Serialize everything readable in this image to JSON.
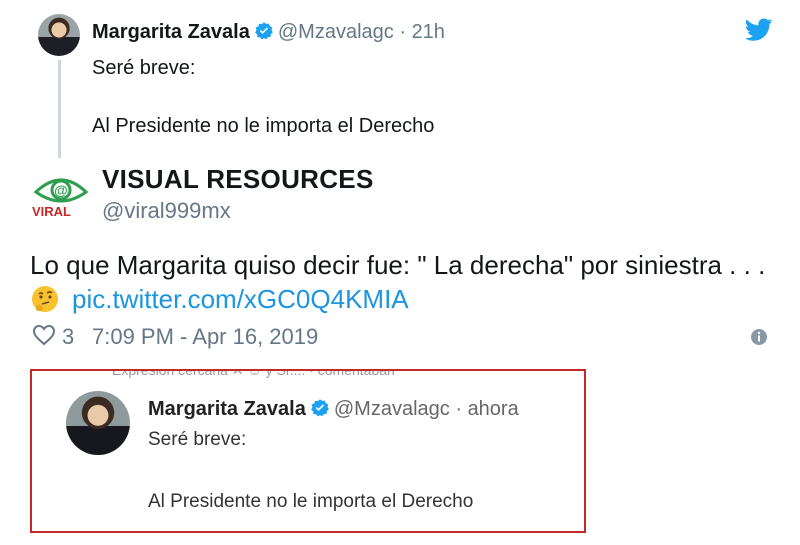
{
  "quoted_tweet": {
    "name": "Margarita Zavala",
    "handle": "@Mzavalagc",
    "separator": "·",
    "time": "21h",
    "line1": "Seré breve:",
    "line2": "Al Presidente no le importa el Derecho"
  },
  "author": {
    "logo_text": "VIRAL",
    "name": "VISUAL RESOURCES",
    "handle": "@viral999mx"
  },
  "tweet": {
    "text": "Lo que Margarita quiso decir fue: \" La derecha\" por siniestra . . .",
    "emoji": "thinking-face-icon",
    "link": "pic.twitter.com/xGC0Q4KMIA"
  },
  "meta": {
    "likes": "3",
    "timestamp": "7:09 PM - Apr 16, 2019"
  },
  "screenshot": {
    "cut_text": "Expresión cercana  ✕  ☺ y Sr.... · comentaban",
    "name": "Margarita Zavala",
    "handle": "@Mzavalagc",
    "separator": "·",
    "time": "ahora",
    "line1": "Seré breve:",
    "line2": "Al Presidente no le importa el Derecho",
    "border_color": "#c62828"
  },
  "colors": {
    "link": "#1b95e0",
    "twitter_blue": "#1da1f2",
    "muted": "#657786"
  }
}
